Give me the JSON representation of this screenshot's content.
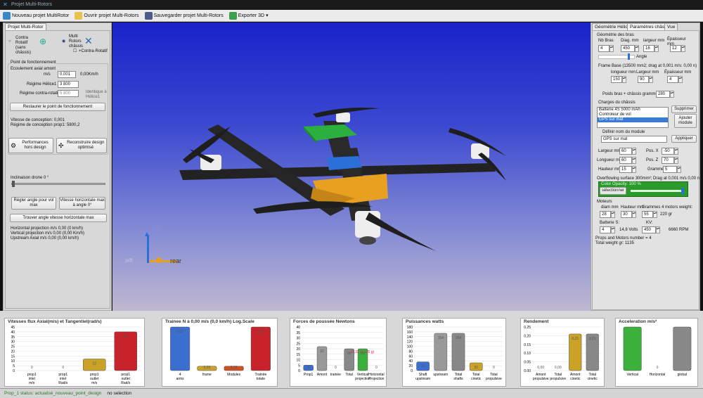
{
  "window": {
    "title": "Projet Multi-Rotors"
  },
  "toolbar": {
    "new": "Nouveau projet MultiRotor",
    "open": "Ouvrir projet Multi-Rotors",
    "save": "Sauvegarder projet Multi-Rotors",
    "export": "Exporter 3D"
  },
  "left": {
    "tab": "Projet Multi-Rotor",
    "contra": "Contra Rotatif (sans châssis)",
    "multi": "Multi Rotors châssis",
    "contra_check": "+Contra-Rotatif",
    "point_title": "Point de fonctionnement",
    "flow_label": "Ecoulement axial amont",
    "ms": "m/s",
    "flow_value": "0,001",
    "flow_kmh": "0,00Km/h",
    "helice_label": "Régime Hélice1",
    "helice_value": "3 800",
    "contra_label": "Régime contra-rotatif",
    "contra_value": "5 800",
    "identique": "Identique à Hélice1",
    "restore": "Restaurer le point de fonctionnement",
    "vitesse_conc": "Vitesse de conception: 0,001",
    "regime_conc": "Régime de conception prop1: 5800,2",
    "perf": "Performances hors design",
    "recon": "Reconstruire design optimisé",
    "inclinaison": "Inclinaison drone 0 °",
    "regler": "Régler angle pour vol max",
    "vitesse_h": "Vitesse horizontale max à angle 0°",
    "trouver": "Trouver angle vitesse horizontale max",
    "proj_h": "Horizontal projection m/s 0,00 (0 km/h)",
    "proj_v": "Vertical projection m/s 0,00 (0,00 Km/h)",
    "upstream": "Upstream Axial m/s 0,00 (0,00 km/h)"
  },
  "viewport": {
    "axis_up": "top",
    "axis_left": "left",
    "axis_right": "rear"
  },
  "right": {
    "tabs": [
      "Géométrie Hélices",
      "Paramètres châssis",
      "Vue"
    ],
    "geo_title": "Géométrie des bras",
    "nb_bras": "Nb Bras",
    "diag": "Diag. mm",
    "largeur": "largeur mm",
    "epaisseur": "Épaisseur mm",
    "nb_val": "4",
    "diag_val": "450",
    "larg_val": "16",
    "ep_val": "12",
    "angle": "Angle",
    "frame_title": "Frame Base (13500 mm2; drag at 0,001 m/s: 0,00 n)",
    "longueur": "longueur mm",
    "largeur2": "Largeur mm",
    "epaisseur2": "Épaisseur mm",
    "f_long": "150",
    "f_larg": "90",
    "f_ep": "4",
    "poids_label": "Poids bras + châssis grammes",
    "poids_val": "280",
    "charges_title": "Charges du châssis",
    "charges": [
      "Batterie 4S 5000 mAh",
      "Controleur de vol",
      "GPS sur mat"
    ],
    "supprimer": "Supprimer",
    "ajouter": "Ajouter module",
    "nom_label": "Définir nom du module",
    "nom_val": "GPS sur mat",
    "appliquer": "Appliquer",
    "lmm": "Largeur mm",
    "lval": "60",
    "lomm": "Longueur mm",
    "loval": "60",
    "hmm": "Hauteur mm",
    "hval": "15",
    "posx": "Pos. X",
    "posxv": "-50",
    "posz": "Pos. Z",
    "poszv": "70",
    "grammes": "Grammes",
    "gval": "5",
    "overflow": "Overflowing surface 300mm²; Drag at 0,001 m/s 0,00 n",
    "color": "Color Opacity: 100 %",
    "selectionner": "sélectionner",
    "moteurs": "Moteurs",
    "diam": "diam mm",
    "haut": "Hauteur mm",
    "gram": "Grammes 4 motors weight:",
    "diam_v": "28",
    "haut_v": "30",
    "gram_v": "55",
    "weight": "220 gr",
    "batterie": "Batterie S:",
    "kv": "KV:",
    "bat_v": "4",
    "volts": "14,8 Volts",
    "kv_v": "450",
    "rpm": "6660 RPM",
    "props": "Props and Motors number = 4",
    "total": "Total weight gr: 1135"
  },
  "charts": [
    {
      "title": "Vitesses flux Axial(m/s) et Tangentiel(rad/s)",
      "ylim": [
        0,
        45
      ],
      "yticks": [
        "45",
        "40",
        "35",
        "30",
        "25",
        "20",
        "15",
        "10",
        "5",
        "0"
      ],
      "categories": [
        "prop1 inlet m/s",
        "prop1 inlet Rad/s",
        "prop1 outlet m/s",
        "prop1 outlet Rad/s"
      ],
      "values": [
        0,
        0,
        12,
        40
      ],
      "labels": [
        "0",
        "0",
        "12",
        "40"
      ],
      "colors": [
        "#3a6fd0",
        "#3a6fd0",
        "#c9a227",
        "#c8222a"
      ]
    },
    {
      "title": "Trainee N à 0,00 m/s (0,0 km/h) Log.Scale",
      "categories": [
        "4 arms",
        "frame",
        "Modules",
        "Trainée totale"
      ],
      "values": [
        1,
        0.1,
        0.1,
        1
      ],
      "labels": [
        "0,00",
        "0,00",
        "0,00",
        "0,00"
      ],
      "colors": [
        "#3a6fd0",
        "#c9a227",
        "#d05020",
        "#c8222a"
      ]
    },
    {
      "title": "Forces de poussée Newtons",
      "ylim": [
        0,
        40
      ],
      "yticks": [
        "40",
        "35",
        "30",
        "25",
        "20",
        "15",
        "10",
        "5",
        "0"
      ],
      "categories": [
        "Prop1",
        "Amont",
        "trainée",
        "Total",
        "Vertical projection",
        "Horizontal Projection"
      ],
      "values": [
        5,
        22,
        0,
        20,
        20,
        0
      ],
      "labels": [
        "5",
        "22",
        "0",
        "20",
        "20",
        "0"
      ],
      "colors": [
        "#3a6fd0",
        "#999",
        "#999",
        "#888",
        "#3bb03b",
        "#999"
      ],
      "note": "11,32 (1 135 g)"
    },
    {
      "title": "Puissances watts",
      "ylim": [
        0,
        180
      ],
      "yticks": [
        "180",
        "160",
        "140",
        "120",
        "100",
        "80",
        "60",
        "40",
        "20",
        "0"
      ],
      "categories": [
        "Shaft upstream",
        "upstream",
        "Total shafts",
        "Total cinetic",
        "Total propulsive"
      ],
      "values": [
        36,
        154,
        154,
        32,
        0
      ],
      "labels": [
        "36",
        "154",
        "154",
        "32",
        "0"
      ],
      "colors": [
        "#3a6fd0",
        "#999",
        "#888",
        "#c9a227",
        "#999"
      ]
    },
    {
      "title": "Rendement",
      "ylim": [
        0,
        0.25
      ],
      "yticks": [
        "0.25",
        "0.20",
        "0.15",
        "0.10",
        "0.05",
        "0.00"
      ],
      "categories": [
        "Amont propulsive",
        "Total propulsive",
        "Amont cinetic",
        "Total cinetic"
      ],
      "values": [
        0,
        0,
        0.21,
        0.21
      ],
      "labels": [
        "0,00",
        "0,00",
        "0,21",
        "0,21"
      ],
      "colors": [
        "#999",
        "#999",
        "#c9a227",
        "#888"
      ]
    },
    {
      "title": "Acceleration m/s²",
      "categories": [
        "Vertical",
        "Horizontal",
        "global"
      ],
      "values": [
        7,
        0,
        7
      ],
      "labels": [
        "",
        "0",
        ""
      ],
      "colors": [
        "#3bb03b",
        "#999",
        "#888"
      ]
    }
  ],
  "status": {
    "text": "Prop_1 status: actualisé_nouveau_point_design",
    "selection": "no selection"
  }
}
